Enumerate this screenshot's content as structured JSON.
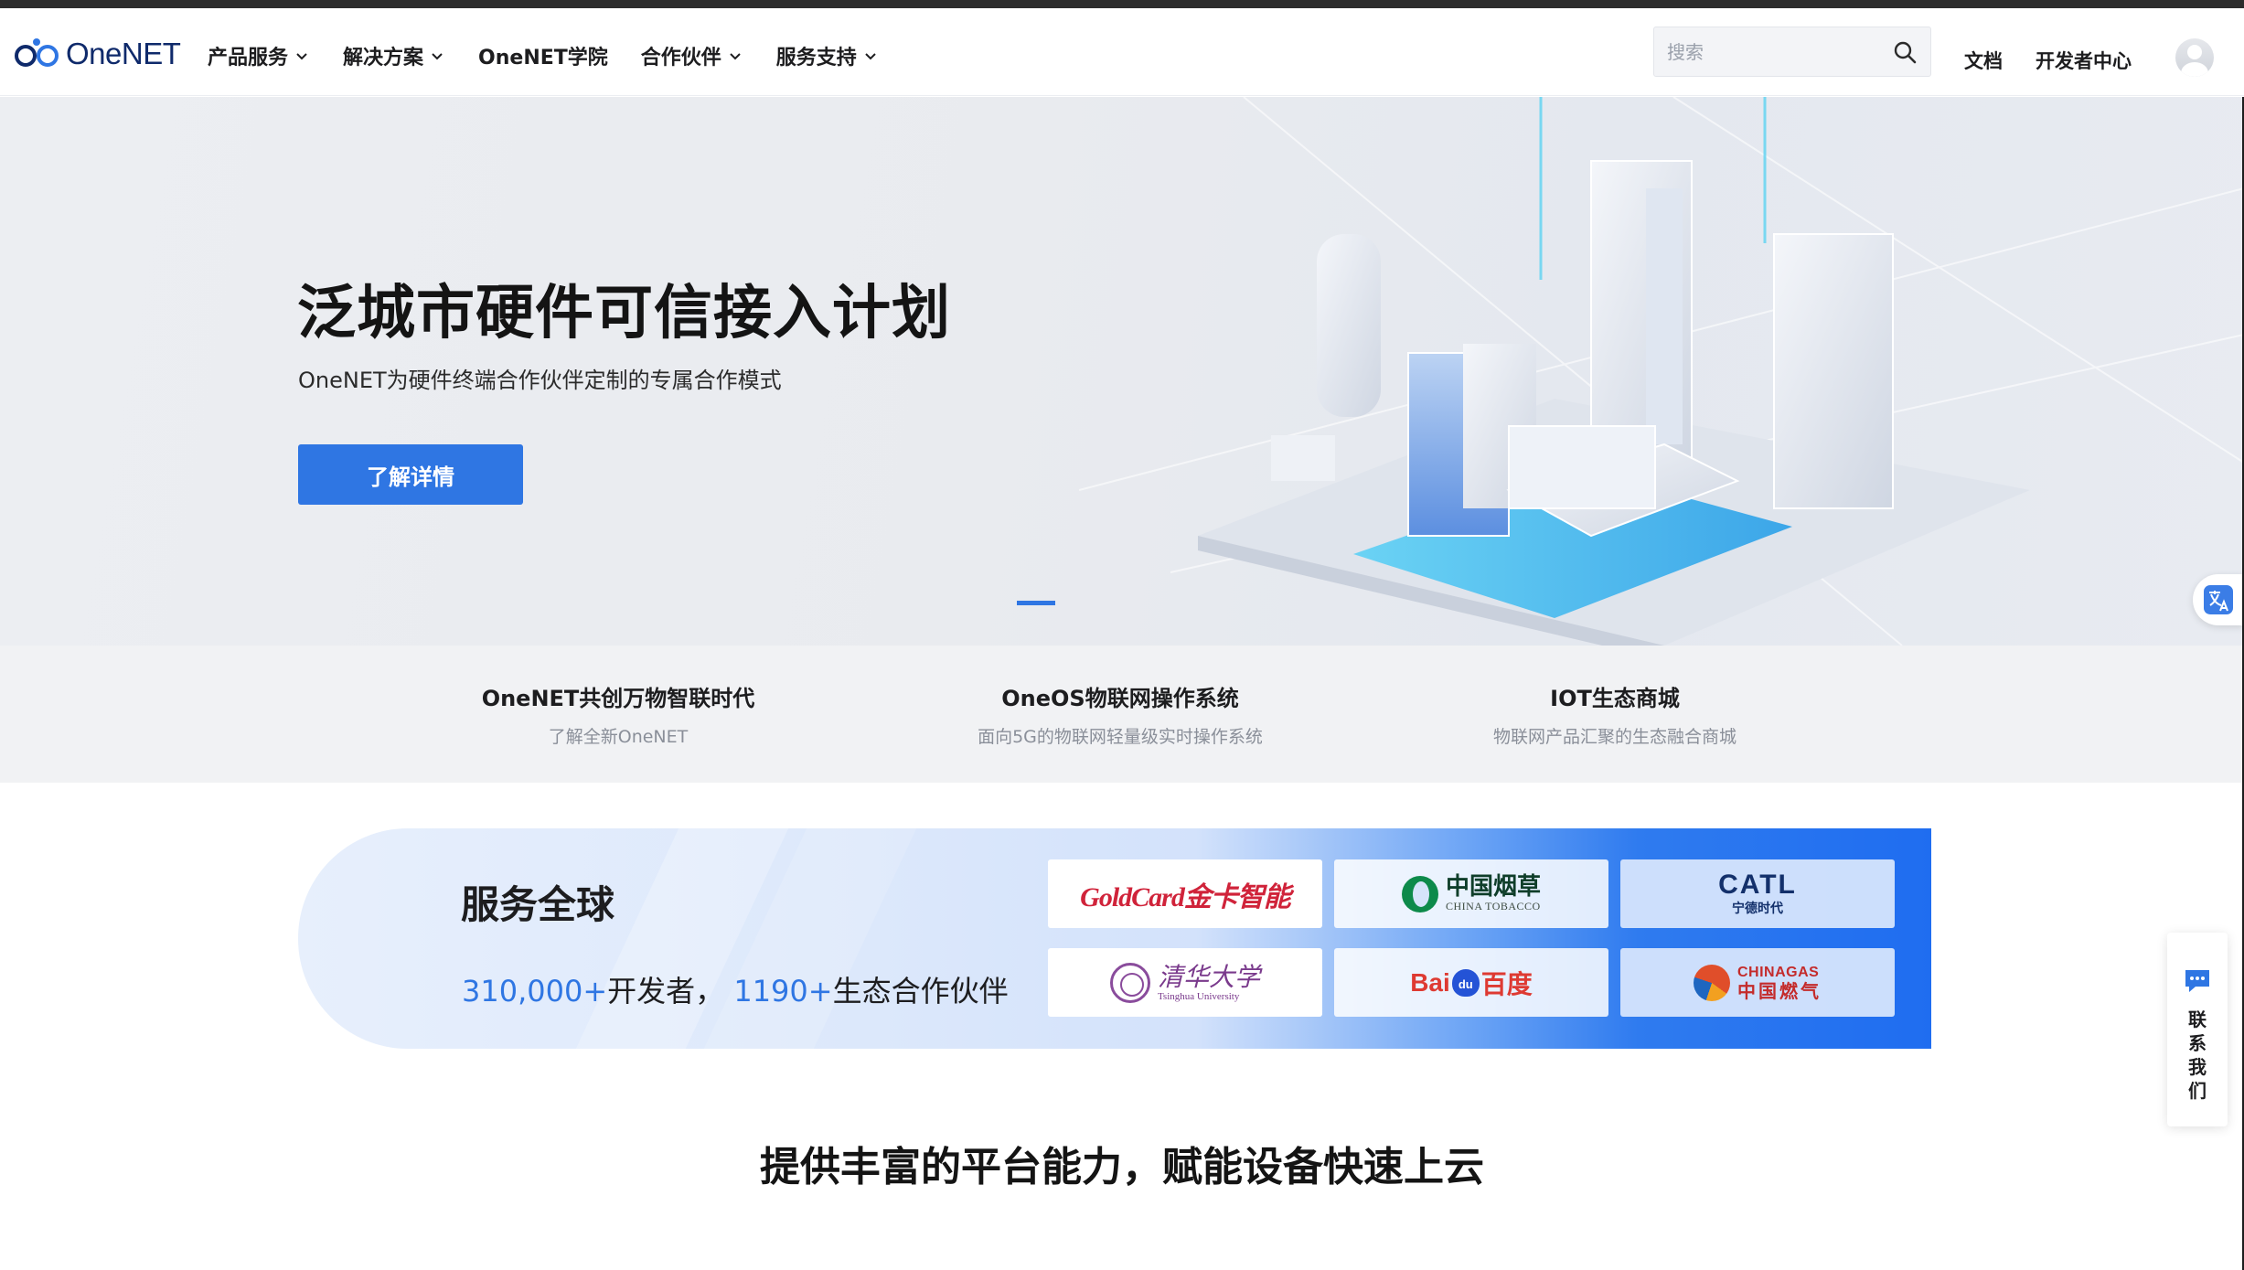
{
  "header": {
    "logo_text": "OneNET",
    "nav": [
      {
        "label": "产品服务",
        "has_dropdown": true
      },
      {
        "label": "解决方案",
        "has_dropdown": true
      },
      {
        "label": "OneNET学院",
        "has_dropdown": false
      },
      {
        "label": "合作伙伴",
        "has_dropdown": true
      },
      {
        "label": "服务支持",
        "has_dropdown": true
      }
    ],
    "search_placeholder": "搜索",
    "docs_link": "文档",
    "dev_center_link": "开发者中心"
  },
  "hero": {
    "title": "泛城市硬件可信接入计划",
    "subtitle": "OneNET为硬件终端合作伙伴定制的专属合作模式",
    "cta": "了解详情",
    "carousel_active_index": 0
  },
  "features": [
    {
      "title": "OneNET共创万物智联时代",
      "desc": "了解全新OneNET"
    },
    {
      "title": "OneOS物联网操作系统",
      "desc": "面向5G的物联网轻量级实时操作系统"
    },
    {
      "title": "IOT生态商城",
      "desc": "物联网产品汇聚的生态融合商城"
    }
  ],
  "service_global": {
    "title": "服务全球",
    "developers_num": "310,000+",
    "developers_label": "开发者，",
    "partners_num": "1190+",
    "partners_label": "生态合作伙伴",
    "partner_logos": {
      "goldcard": "GoldCard金卡智能",
      "tobacco_cn": "中国烟草",
      "tobacco_en": "CHINA TOBACCO",
      "catl_en": "CATL",
      "catl_cn": "宁德时代",
      "tsinghua_cn": "清华大学",
      "tsinghua_en": "Tsinghua University",
      "baidu_a": "Bai",
      "baidu_paw": "du",
      "baidu_cn": "百度",
      "gas_en": "CHINAGAS",
      "gas_cn": "中国燃气"
    }
  },
  "section_title": "提供丰富的平台能力，赋能设备快速上云",
  "contact": [
    "联",
    "系",
    "我",
    "们"
  ],
  "colors": {
    "accent": "#2f76e3",
    "text": "#1d1d1f",
    "muted": "#8a8f99"
  },
  "icons": [
    "search-icon",
    "chevron-down-icon",
    "translate-icon",
    "chat-icon",
    "avatar"
  ]
}
